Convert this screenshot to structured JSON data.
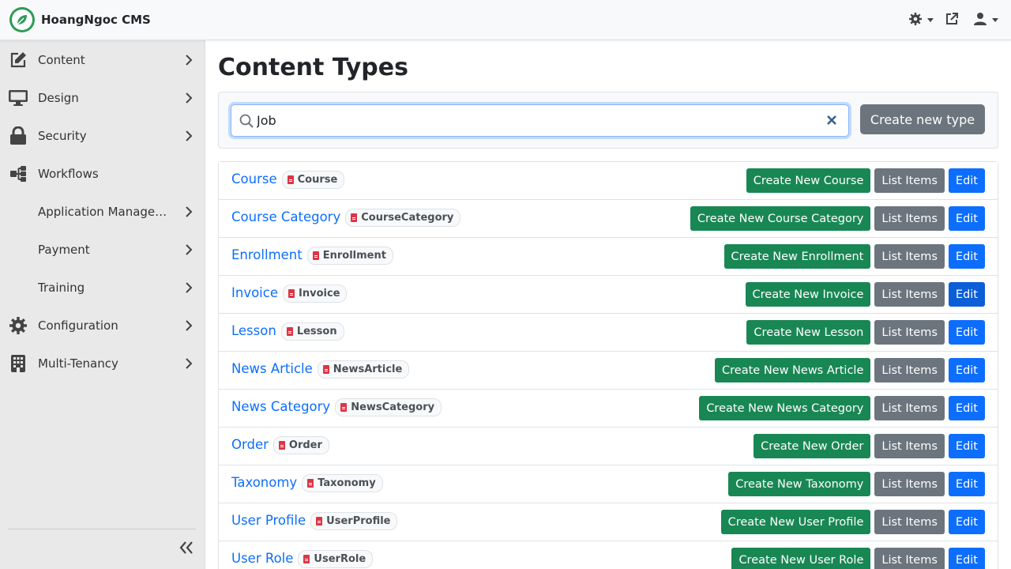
{
  "header": {
    "brand_name": "HoangNgoc CMS",
    "icons": [
      "leaf-logo",
      "theme-gear-icon",
      "external-link-icon",
      "user-icon"
    ]
  },
  "sidebar": {
    "items": [
      {
        "label": "Content",
        "icon": "edit-icon",
        "top": 0
      },
      {
        "label": "Design",
        "icon": "monitor-icon"
      },
      {
        "label": "Security",
        "icon": "lock-icon"
      },
      {
        "label": "Workflows",
        "icon": "workflow-icon"
      },
      {
        "label": "Application Management"
      },
      {
        "label": "Payment"
      },
      {
        "label": "Training"
      },
      {
        "label": "Configuration",
        "icon": "gear-icon"
      },
      {
        "label": "Multi-Tenancy",
        "icon": "building-icon"
      }
    ],
    "collapse_label": "«"
  },
  "main": {
    "title": "Content Types",
    "search": {
      "value": "Job",
      "placeholder": ""
    },
    "create_new_type_label": "Create new type",
    "list_items_label": "List Items",
    "edit_label": "Edit",
    "rows": [
      {
        "name": "Course",
        "technical": "Course",
        "create_label": "Create New Course"
      },
      {
        "name": "Course Category",
        "technical": "CourseCategory",
        "create_label": "Create New Course Category"
      },
      {
        "name": "Enrollment",
        "technical": "Enrollment",
        "create_label": "Create New Enrollment"
      },
      {
        "name": "Invoice",
        "technical": "Invoice",
        "create_label": "Create New Invoice"
      },
      {
        "name": "Lesson",
        "technical": "Lesson",
        "create_label": "Create New Lesson"
      },
      {
        "name": "News Article",
        "technical": "NewsArticle",
        "create_label": "Create New News Article"
      },
      {
        "name": "News Category",
        "technical": "NewsCategory",
        "create_label": "Create New News Category"
      },
      {
        "name": "Order",
        "technical": "Order",
        "create_label": "Create New Order"
      },
      {
        "name": "Taxonomy",
        "technical": "Taxonomy",
        "create_label": "Create New Taxonomy"
      },
      {
        "name": "User Profile",
        "technical": "UserProfile",
        "create_label": "Create New User Profile"
      },
      {
        "name": "User Role",
        "technical": "UserRole",
        "create_label": "Create New User Role"
      }
    ]
  },
  "colors": {
    "primary": "#0d6efd",
    "success": "#198754",
    "secondary": "#6c757d",
    "brand": "#2e9b57",
    "sidebar_bg": "#e9e9ea"
  }
}
